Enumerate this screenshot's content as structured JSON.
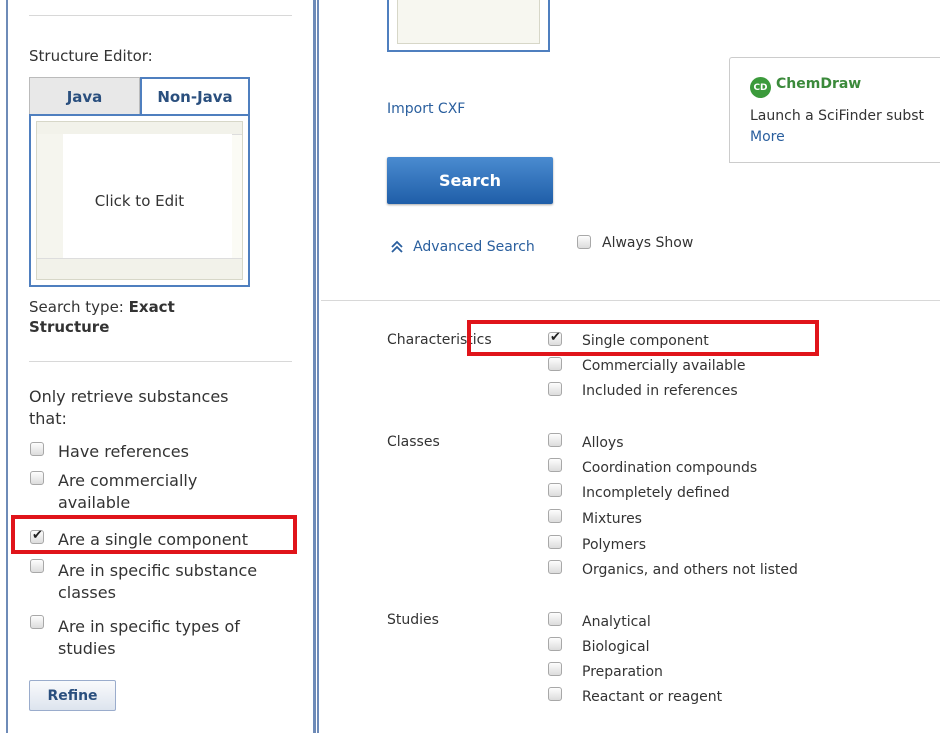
{
  "left": {
    "structure_editor_label": "Structure Editor:",
    "tabs": [
      {
        "label": "Java",
        "active": false
      },
      {
        "label": "Non-Java",
        "active": true
      }
    ],
    "click_to_edit": "Click to Edit",
    "search_type_prefix": "Search type: ",
    "search_type_value_line1": "Exact",
    "search_type_value_line2": "Structure",
    "retrieve_label_line1": "Only retrieve substances",
    "retrieve_label_line2": "that:",
    "options": [
      {
        "label_lines": [
          "Have references"
        ],
        "checked": false
      },
      {
        "label_lines": [
          "Are commercially",
          "available"
        ],
        "checked": false
      },
      {
        "label_lines": [
          "Are a single component"
        ],
        "checked": true
      },
      {
        "label_lines": [
          "Are in specific substance",
          "classes"
        ],
        "checked": false
      },
      {
        "label_lines": [
          "Are in specific types of",
          "studies"
        ],
        "checked": false
      }
    ],
    "refine_label": "Refine"
  },
  "right": {
    "import_cxf": "Import CXF",
    "search_label": "Search",
    "advanced_search": "Advanced Search",
    "always_show": "Always Show",
    "chemdraw": {
      "title": "ChemDraw",
      "logo_text": "CD",
      "text": "Launch a SciFinder subst",
      "more": "More"
    },
    "characteristics": {
      "label": "Characteristics",
      "options": [
        {
          "label": "Single component",
          "checked": true
        },
        {
          "label": "Commercially available",
          "checked": false
        },
        {
          "label": "Included in references",
          "checked": false
        }
      ]
    },
    "classes": {
      "label": "Classes",
      "options": [
        {
          "label": "Alloys",
          "checked": false
        },
        {
          "label": "Coordination compounds",
          "checked": false
        },
        {
          "label": "Incompletely defined",
          "checked": false
        },
        {
          "label": "Mixtures",
          "checked": false
        },
        {
          "label": "Polymers",
          "checked": false
        },
        {
          "label": "Organics, and others not listed",
          "checked": false
        }
      ]
    },
    "studies": {
      "label": "Studies",
      "options": [
        {
          "label": "Analytical",
          "checked": false
        },
        {
          "label": "Biological",
          "checked": false
        },
        {
          "label": "Preparation",
          "checked": false
        },
        {
          "label": "Reactant or reagent",
          "checked": false
        }
      ]
    }
  },
  "colors": {
    "frame_blue": "#6e8bb8",
    "highlight_red": "#e0141a",
    "search_button_blue": "#1f5ea8",
    "link_blue": "#2a5f9e",
    "chemdraw_green": "#3b8a3b"
  },
  "icons": [
    "chevron-double-up-icon",
    "chemdraw-logo-icon",
    "checkbox-icon"
  ]
}
